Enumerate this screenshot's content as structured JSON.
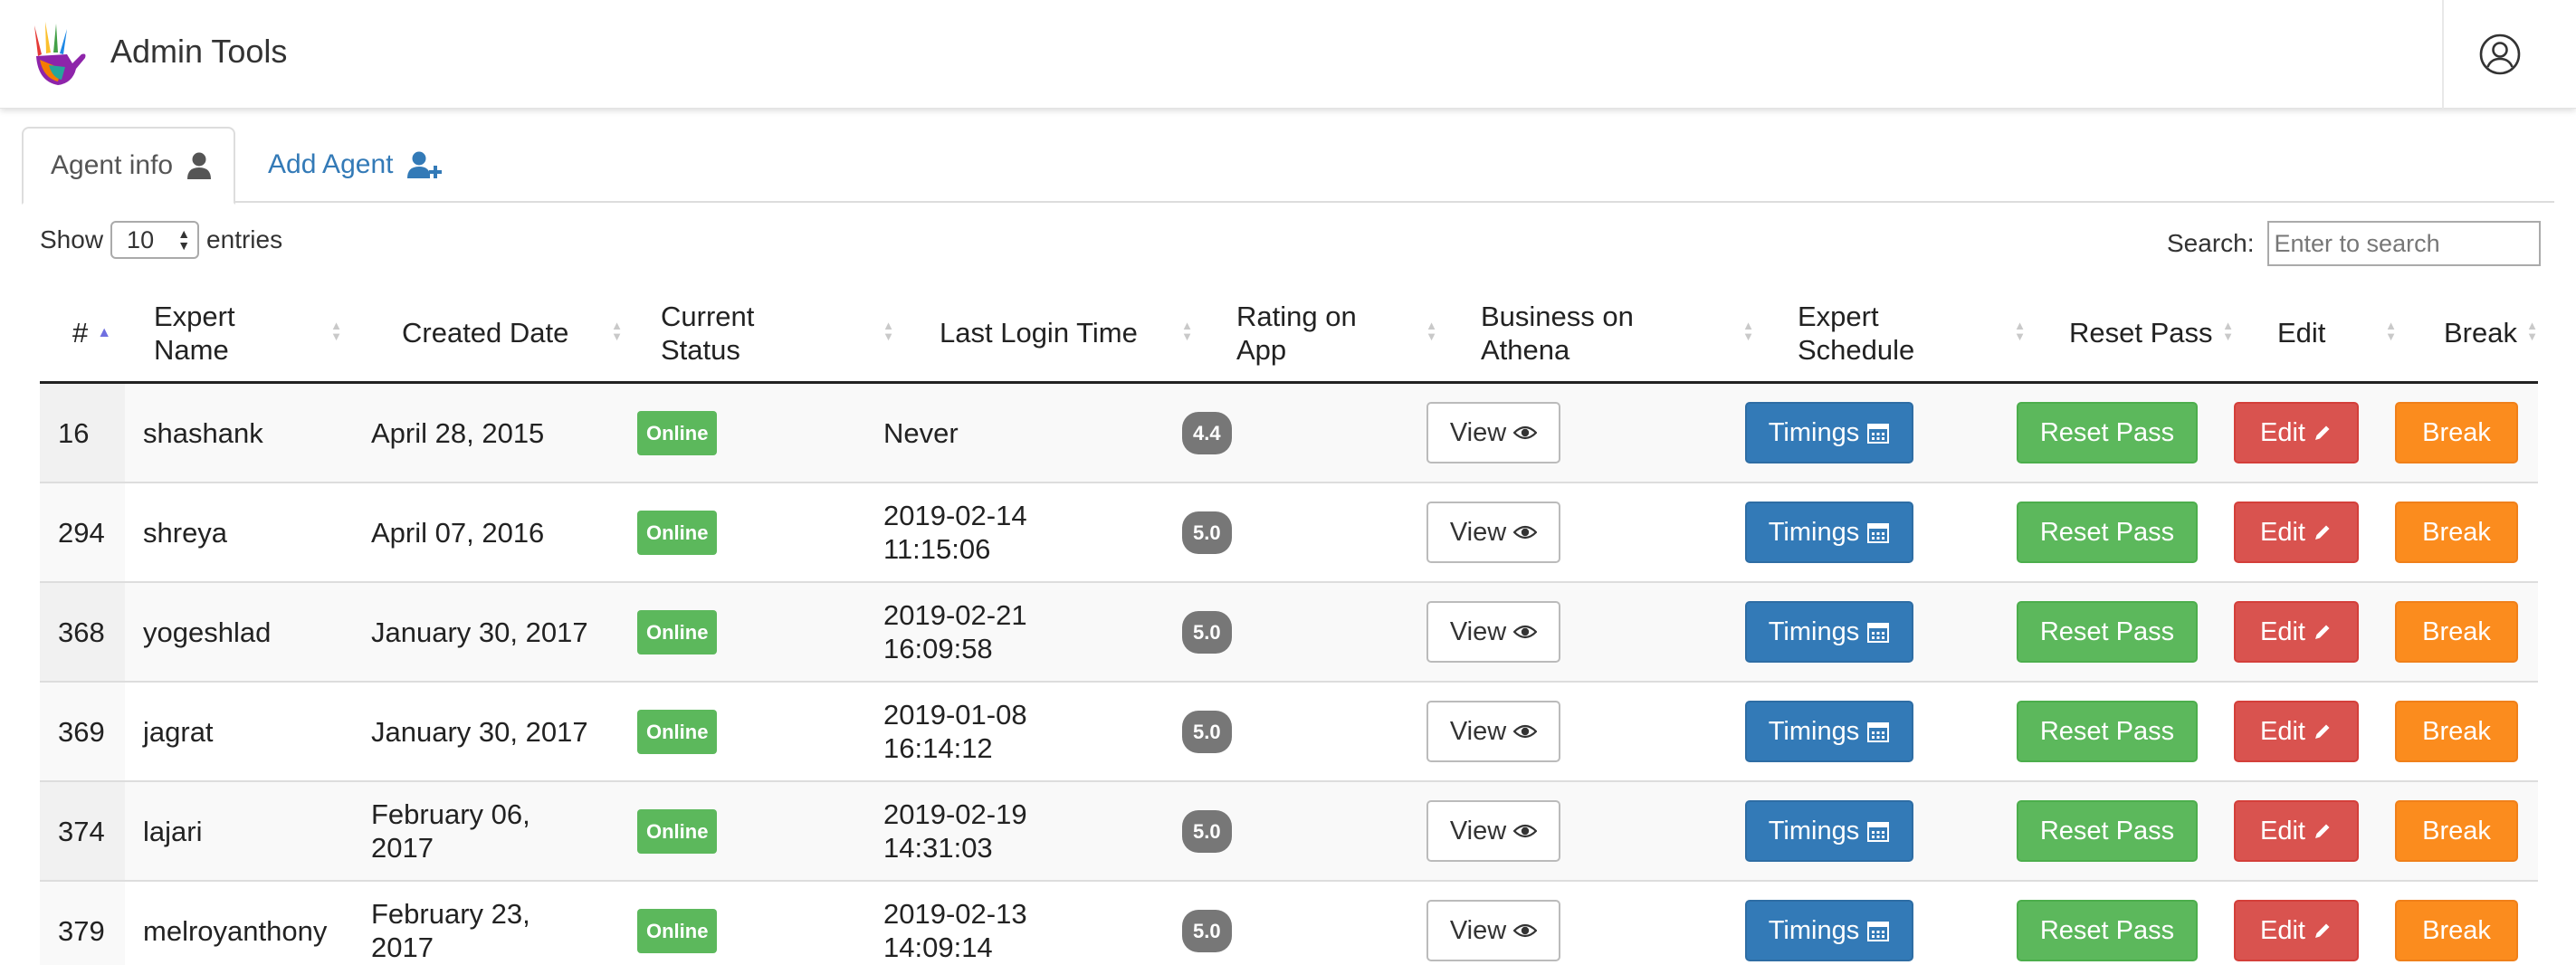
{
  "app": {
    "title": "Admin Tools",
    "accent": "#337ab7"
  },
  "tabs": [
    {
      "label": "Agent info",
      "icon": "user-icon",
      "active": true
    },
    {
      "label": "Add Agent",
      "icon": "user-plus-icon",
      "active": false
    }
  ],
  "controls": {
    "show_label": "Show",
    "entries_value": "10",
    "entries_label": "entries",
    "search_label": "Search:",
    "search_placeholder": "Enter to search"
  },
  "table": {
    "columns": [
      "#",
      "Expert Name",
      "Created Date",
      "Current Status",
      "Last Login Time",
      "Rating on App",
      "Business on Athena",
      "Expert Schedule",
      "Reset Pass",
      "Edit",
      "Break"
    ],
    "sorted_column": "#",
    "sort_direction": "asc",
    "action_labels": {
      "view": "View",
      "timings": "Timings",
      "reset": "Reset Pass",
      "edit": "Edit",
      "break": "Break"
    },
    "rows": [
      {
        "id": "16",
        "name": "shashank",
        "created": "April 28, 2015",
        "status": "Online",
        "last_login": "Never",
        "rating": "4.4"
      },
      {
        "id": "294",
        "name": "shreya",
        "created": "April 07, 2016",
        "status": "Online",
        "last_login": "2019-02-14 11:15:06",
        "rating": "5.0"
      },
      {
        "id": "368",
        "name": "yogeshlad",
        "created": "January 30, 2017",
        "status": "Online",
        "last_login": "2019-02-21 16:09:58",
        "rating": "5.0"
      },
      {
        "id": "369",
        "name": "jagrat",
        "created": "January 30, 2017",
        "status": "Online",
        "last_login": "2019-01-08 16:14:12",
        "rating": "5.0"
      },
      {
        "id": "374",
        "name": "lajari",
        "created": "February 06, 2017",
        "status": "Online",
        "last_login": "2019-02-19 14:31:03",
        "rating": "5.0"
      },
      {
        "id": "379",
        "name": "melroyanthony",
        "created": "February 23, 2017",
        "status": "Online",
        "last_login": "2019-02-13 14:09:14",
        "rating": "5.0"
      }
    ]
  },
  "colors": {
    "online": "#5cb85c",
    "rating": "#777777",
    "timings": "#337ab7",
    "reset": "#5cb85c",
    "edit": "#d9534f",
    "break": "#fb8c1e"
  }
}
